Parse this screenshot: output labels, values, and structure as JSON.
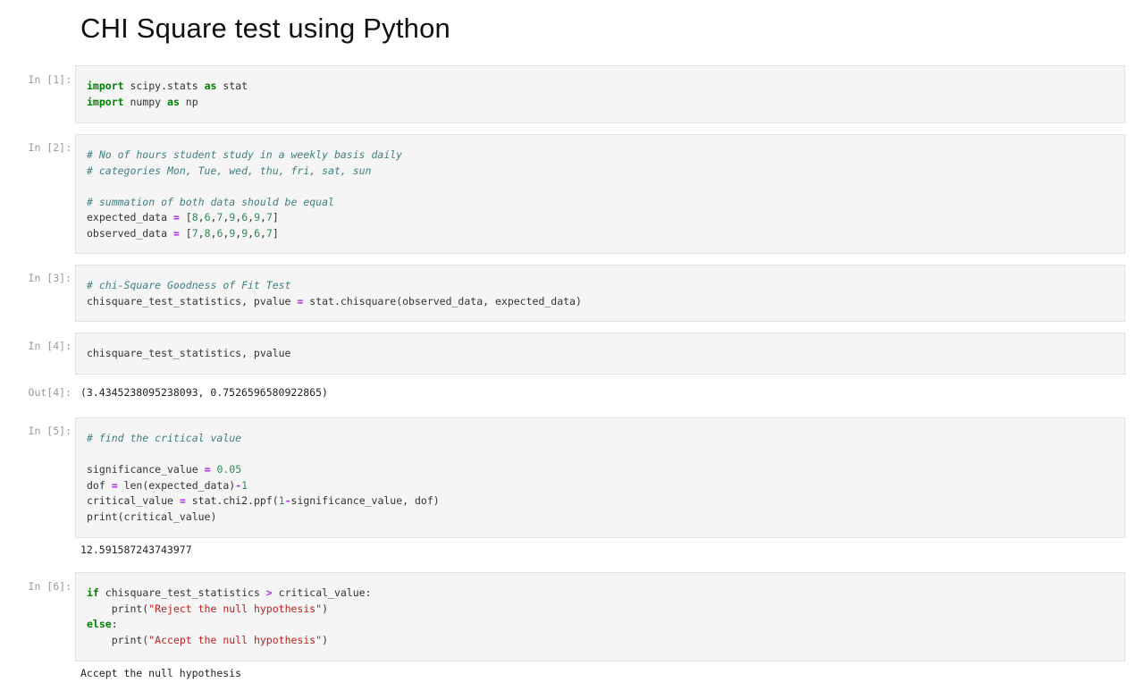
{
  "notebook": {
    "title": "CHI Square test using Python",
    "cells": [
      {
        "prompt": "In [1]:",
        "lines": [
          [
            {
              "t": "import",
              "c": "kw"
            },
            {
              "t": " scipy.stats "
            },
            {
              "t": "as",
              "c": "kw"
            },
            {
              "t": " stat"
            }
          ],
          [
            {
              "t": "import",
              "c": "kw"
            },
            {
              "t": " numpy "
            },
            {
              "t": "as",
              "c": "kw"
            },
            {
              "t": " np"
            }
          ]
        ]
      },
      {
        "prompt": "In [2]:",
        "lines": [
          [
            {
              "t": "# No of hours student study in a weekly basis daily",
              "c": "cm"
            }
          ],
          [
            {
              "t": "# categories Mon, Tue, wed, thu, fri, sat, sun",
              "c": "cm"
            }
          ],
          [
            {
              "t": ""
            }
          ],
          [
            {
              "t": "# summation of both data should be equal",
              "c": "cm"
            }
          ],
          [
            {
              "t": "expected_data "
            },
            {
              "t": "=",
              "c": "op"
            },
            {
              "t": " ["
            },
            {
              "t": "8",
              "c": "num"
            },
            {
              "t": ","
            },
            {
              "t": "6",
              "c": "num"
            },
            {
              "t": ","
            },
            {
              "t": "7",
              "c": "num"
            },
            {
              "t": ","
            },
            {
              "t": "9",
              "c": "num"
            },
            {
              "t": ","
            },
            {
              "t": "6",
              "c": "num"
            },
            {
              "t": ","
            },
            {
              "t": "9",
              "c": "num"
            },
            {
              "t": ","
            },
            {
              "t": "7",
              "c": "num"
            },
            {
              "t": "]"
            }
          ],
          [
            {
              "t": "observed_data "
            },
            {
              "t": "=",
              "c": "op"
            },
            {
              "t": " ["
            },
            {
              "t": "7",
              "c": "num"
            },
            {
              "t": ","
            },
            {
              "t": "8",
              "c": "num"
            },
            {
              "t": ","
            },
            {
              "t": "6",
              "c": "num"
            },
            {
              "t": ","
            },
            {
              "t": "9",
              "c": "num"
            },
            {
              "t": ","
            },
            {
              "t": "9",
              "c": "num"
            },
            {
              "t": ","
            },
            {
              "t": "6",
              "c": "num"
            },
            {
              "t": ","
            },
            {
              "t": "7",
              "c": "num"
            },
            {
              "t": "]"
            }
          ]
        ]
      },
      {
        "prompt": "In [3]:",
        "lines": [
          [
            {
              "t": "# chi-Square Goodness of Fit Test",
              "c": "cm"
            }
          ],
          [
            {
              "t": "chisquare_test_statistics, pvalue "
            },
            {
              "t": "=",
              "c": "op"
            },
            {
              "t": " stat.chisquare(observed_data, expected_data)"
            }
          ]
        ]
      },
      {
        "prompt": "In [4]:",
        "lines": [
          [
            {
              "t": "chisquare_test_statistics, pvalue"
            }
          ]
        ],
        "out_prompt": "Out[4]:",
        "output": "(3.4345238095238093, 0.7526596580922865)"
      },
      {
        "prompt": "In [5]:",
        "lines": [
          [
            {
              "t": "# find the critical value",
              "c": "cm"
            }
          ],
          [
            {
              "t": ""
            }
          ],
          [
            {
              "t": "significance_value "
            },
            {
              "t": "=",
              "c": "op"
            },
            {
              "t": " "
            },
            {
              "t": "0.05",
              "c": "num"
            }
          ],
          [
            {
              "t": "dof "
            },
            {
              "t": "=",
              "c": "op"
            },
            {
              "t": " len(expected_data)"
            },
            {
              "t": "-",
              "c": "op"
            },
            {
              "t": "1",
              "c": "num"
            }
          ],
          [
            {
              "t": "critical_value "
            },
            {
              "t": "=",
              "c": "op"
            },
            {
              "t": " stat.chi2.ppf("
            },
            {
              "t": "1",
              "c": "num"
            },
            {
              "t": "-",
              "c": "op"
            },
            {
              "t": "significance_value, dof)"
            }
          ],
          [
            {
              "t": "print(critical_value)"
            }
          ]
        ],
        "output": "12.591587243743977"
      },
      {
        "prompt": "In [6]:",
        "lines": [
          [
            {
              "t": "if",
              "c": "kw"
            },
            {
              "t": " chisquare_test_statistics "
            },
            {
              "t": ">",
              "c": "op"
            },
            {
              "t": " critical_value:"
            }
          ],
          [
            {
              "t": "    print("
            },
            {
              "t": "\"Reject the null hypothesis\"",
              "c": "str"
            },
            {
              "t": ")"
            }
          ],
          [
            {
              "t": "else",
              "c": "kw"
            },
            {
              "t": ":"
            }
          ],
          [
            {
              "t": "    print("
            },
            {
              "t": "\"Accept the null hypothesis\"",
              "c": "str"
            },
            {
              "t": ")"
            }
          ]
        ],
        "output": "Accept the null hypothesis"
      }
    ]
  }
}
